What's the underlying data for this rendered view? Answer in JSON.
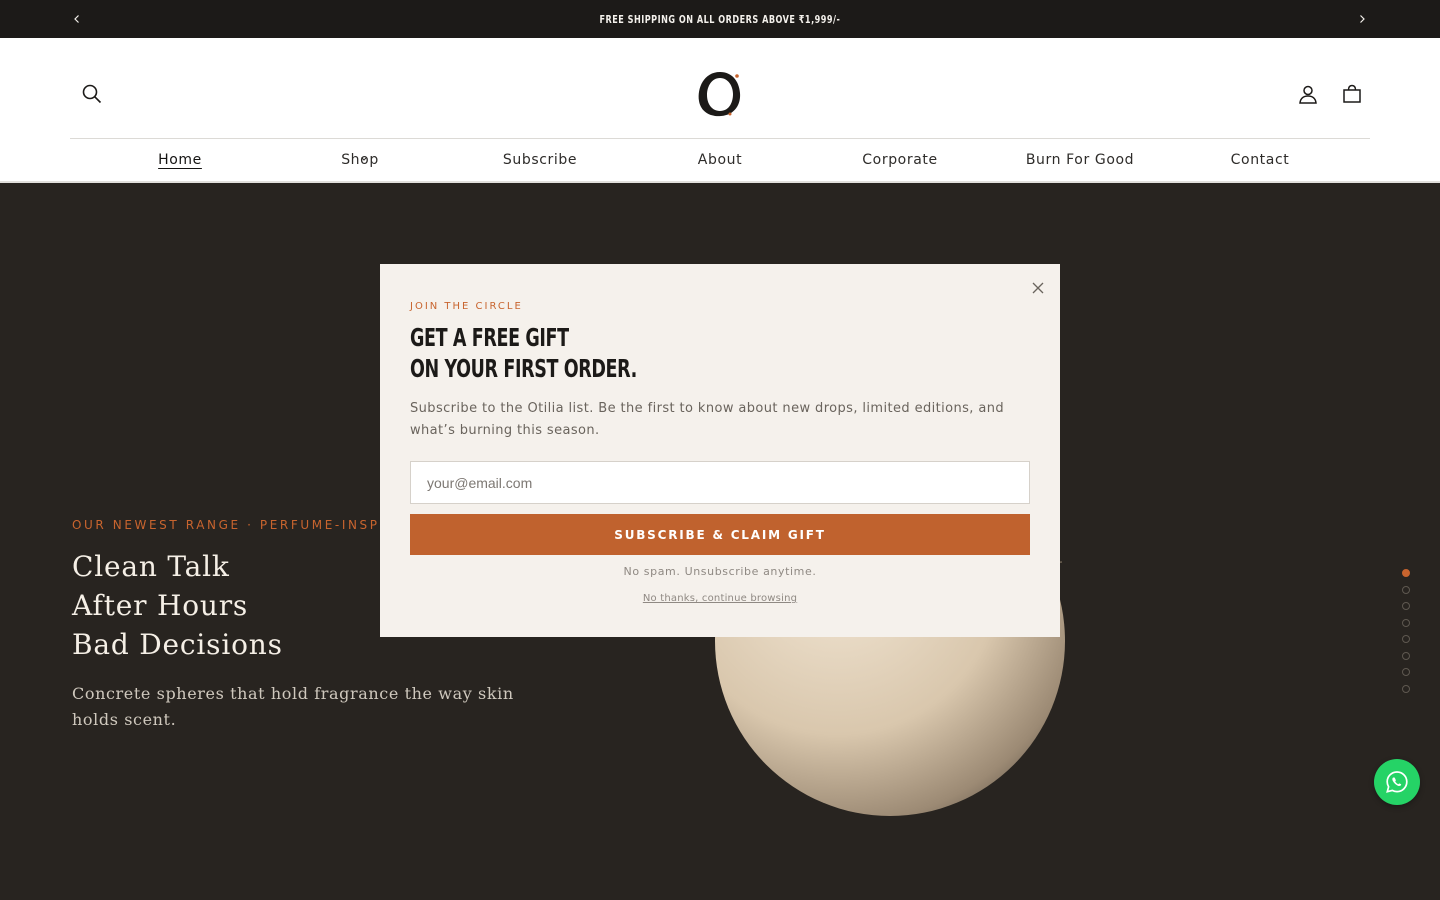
{
  "announcement": {
    "text": "FREE SHIPPING ON ALL ORDERS ABOVE ₹1,999/-",
    "prev_icon": "chevron-left-icon",
    "next_icon": "chevron-right-icon"
  },
  "header": {
    "icons": [
      "search-icon",
      "account-icon",
      "cart-icon"
    ],
    "logo": "brand-logo"
  },
  "nav": {
    "items": [
      {
        "label": "Home",
        "active": true
      },
      {
        "label": "Shop",
        "active": false
      },
      {
        "label": "Subscribe",
        "active": false
      },
      {
        "label": "About",
        "active": false
      },
      {
        "label": "Corporate",
        "active": false
      },
      {
        "label": "Burn For Good",
        "active": false
      },
      {
        "label": "Contact",
        "active": false
      }
    ]
  },
  "hero": {
    "kicker": "OUR NEWEST RANGE · PERFUME-INSPIRED",
    "lines": [
      "Clean Talk",
      "After Hours",
      "Bad Decisions"
    ],
    "subtitle": "Concrete spheres that hold fragrance the way skin holds scent.",
    "slide_count": 8,
    "active_slide": 1
  },
  "modal": {
    "kicker": "JOIN THE CIRCLE",
    "title_line1": "GET A FREE GIFT",
    "title_line2": "ON YOUR FIRST ORDER.",
    "body": "Subscribe to the Otilia list. Be the first to know about new drops, limited editions, and what’s burning this season.",
    "email_placeholder": "your@email.com",
    "email_value": "",
    "button_label": "SUBSCRIBE & CLAIM GIFT",
    "note": "No spam. Unsubscribe anytime.",
    "dismiss_label": "No thanks, continue browsing"
  },
  "colors": {
    "accent": "#c0622e",
    "hero_bg": "#282420",
    "announcement_bg": "#1c1a18",
    "modal_bg": "#f5f1ec",
    "whatsapp": "#25d366"
  }
}
